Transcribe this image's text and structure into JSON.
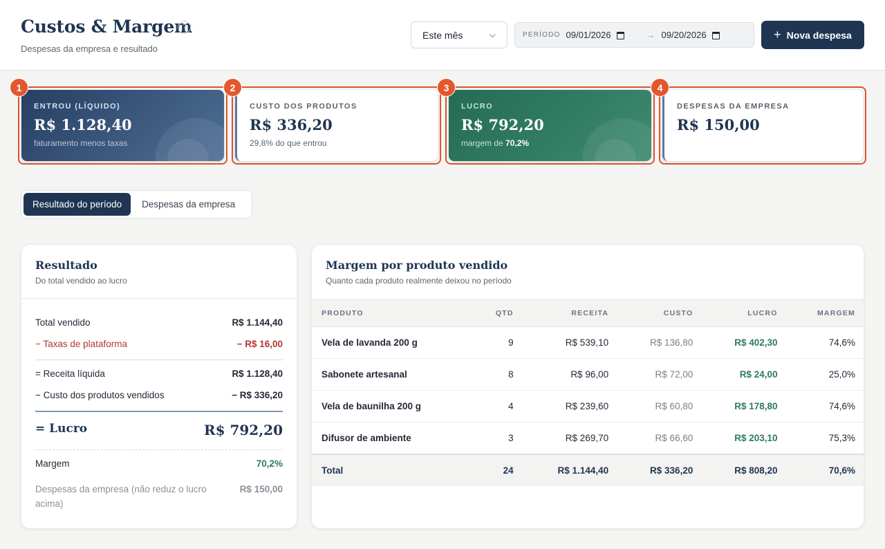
{
  "header": {
    "title": "Custos & Margem",
    "help": "?",
    "subtitle": "Despesas da empresa e resultado",
    "period_select": "Este mês",
    "period_label": "PERÍODO",
    "date_from": "09/01/2026",
    "date_to": "09/20/2026",
    "arrow": "→",
    "new_button": "Nova despesa",
    "new_button_icon": "+"
  },
  "kpis": [
    {
      "badge": "1",
      "label": "ENTROU (LÍQUIDO)",
      "value": "R$ 1.128,40",
      "note": "faturamento menos taxas"
    },
    {
      "badge": "2",
      "label": "CUSTO DOS PRODUTOS",
      "value": "R$ 336,20",
      "note": "29,8% do que entrou"
    },
    {
      "badge": "3",
      "label": "LUCRO",
      "value": "R$ 792,20",
      "note_prefix": "margem de ",
      "note_strong": "70,2%"
    },
    {
      "badge": "4",
      "label": "DESPESAS DA EMPRESA",
      "value": "R$ 150,00"
    }
  ],
  "tabs": [
    "Resultado do período",
    "Despesas da empresa"
  ],
  "result": {
    "title": "Resultado",
    "subtitle": "Do total vendido ao lucro",
    "rows": [
      {
        "label": "Total vendido",
        "value": "R$ 1.144,40"
      },
      {
        "label": "− Taxas de plataforma",
        "value": "− R$ 16,00"
      },
      {
        "label": "= Receita líquida",
        "value": "R$ 1.128,40"
      },
      {
        "label": "− Custo dos produtos vendidos",
        "value": "− R$ 336,20"
      },
      {
        "label": "= Lucro",
        "value": "R$ 792,20"
      },
      {
        "label": "Margem",
        "value": "70,2%"
      },
      {
        "label": "Despesas da empresa (não reduz o lucro acima)",
        "value": "R$ 150,00"
      }
    ]
  },
  "margin": {
    "title": "Margem por produto vendido",
    "subtitle": "Quanto cada produto realmente deixou no período",
    "columns": [
      "PRODUTO",
      "QTD",
      "RECEITA",
      "CUSTO",
      "LUCRO",
      "MARGEM"
    ],
    "rows": [
      [
        "Vela de lavanda 200 g",
        "9",
        "R$ 539,10",
        "R$ 136,80",
        "R$ 402,30",
        "74,6%"
      ],
      [
        "Sabonete artesanal",
        "8",
        "R$ 96,00",
        "R$ 72,00",
        "R$ 24,00",
        "25,0%"
      ],
      [
        "Vela de baunilha 200 g",
        "4",
        "R$ 239,60",
        "R$ 60,80",
        "R$ 178,80",
        "74,6%"
      ],
      [
        "Difusor de ambiente",
        "3",
        "R$ 269,70",
        "R$ 66,60",
        "R$ 203,10",
        "75,3%"
      ]
    ],
    "total": [
      "Total",
      "24",
      "R$ 1.144,40",
      "R$ 336,20",
      "R$ 808,20",
      "70,6%"
    ]
  }
}
